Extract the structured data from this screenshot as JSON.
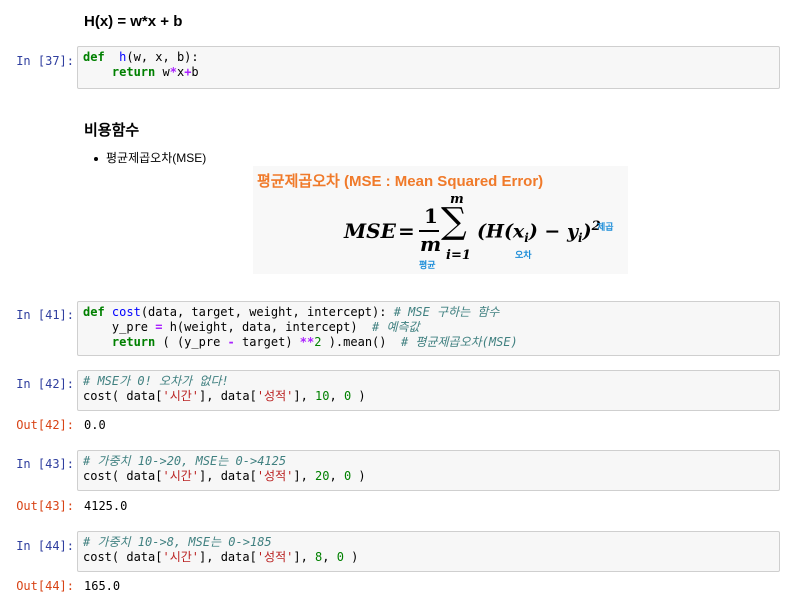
{
  "markdown": {
    "h1": "H(x) = w*x + b",
    "h2": "비용함수",
    "bullet": "평균제곱오차(MSE)"
  },
  "formula_image": {
    "title": "평균제곱오차 (MSE : Mean Squared Error)",
    "lhs": "MSE",
    "eq": "=",
    "frac_num": "1",
    "frac_den": "m",
    "sum_top": "m",
    "sum_bottom": "i=1",
    "body": "(H(x",
    "sub_i": "i",
    "minus_y": ") − y",
    "close": ")",
    "sq": "2",
    "label_avg": "평균",
    "label_err": "오차",
    "label_sq": "제곱",
    "title_color": "#f07a2a",
    "label_color": "#1a8cd8"
  },
  "cells": [
    {
      "prompt": "In [37]:",
      "lines": [
        [
          [
            "kw",
            "def"
          ],
          [
            "",
            "  "
          ],
          [
            "fn",
            "h"
          ],
          [
            "",
            "(w, x, b):"
          ]
        ],
        [
          [
            "",
            "    "
          ],
          [
            "kw",
            "return"
          ],
          [
            "",
            " w"
          ],
          [
            "op",
            "*"
          ],
          [
            "",
            "x"
          ],
          [
            "op",
            "+"
          ],
          [
            "",
            "b"
          ]
        ]
      ]
    },
    {
      "prompt": "In [41]:",
      "lines": [
        [
          [
            "kw",
            "def"
          ],
          [
            "",
            " "
          ],
          [
            "fn",
            "cost"
          ],
          [
            "",
            "(data, target, weight, intercept): "
          ],
          [
            "cm",
            "# MSE 구하는 함수"
          ]
        ],
        [
          [
            "",
            "    y_pre "
          ],
          [
            "op",
            "="
          ],
          [
            "",
            " h(weight, data, intercept)  "
          ],
          [
            "cm",
            "# 예측값"
          ]
        ],
        [
          [
            "",
            "    "
          ],
          [
            "kw",
            "return"
          ],
          [
            "",
            " ( (y_pre "
          ],
          [
            "op",
            "-"
          ],
          [
            "",
            " target) "
          ],
          [
            "op",
            "**"
          ],
          [
            "num",
            "2"
          ],
          [
            "",
            " ).mean()  "
          ],
          [
            "cm",
            "# 평균제곱오차(MSE)"
          ]
        ]
      ]
    },
    {
      "prompt": "In [42]:",
      "out_prompt": "Out[42]:",
      "output": "0.0",
      "lines": [
        [
          [
            "cm",
            "# MSE가 0! 오차가 없다!"
          ]
        ],
        [
          [
            "",
            "cost( data["
          ],
          [
            "str",
            "'시간'"
          ],
          [
            "",
            "], data["
          ],
          [
            "str",
            "'성적'"
          ],
          [
            "",
            "], "
          ],
          [
            "num",
            "10"
          ],
          [
            "",
            ", "
          ],
          [
            "num",
            "0"
          ],
          [
            "",
            " )"
          ]
        ]
      ]
    },
    {
      "prompt": "In [43]:",
      "out_prompt": "Out[43]:",
      "output": "4125.0",
      "lines": [
        [
          [
            "cm",
            "# 가중치 10->20, MSE는 0->4125"
          ]
        ],
        [
          [
            "",
            "cost( data["
          ],
          [
            "str",
            "'시간'"
          ],
          [
            "",
            "], data["
          ],
          [
            "str",
            "'성적'"
          ],
          [
            "",
            "], "
          ],
          [
            "num",
            "20"
          ],
          [
            "",
            ", "
          ],
          [
            "num",
            "0"
          ],
          [
            "",
            " )"
          ]
        ]
      ]
    },
    {
      "prompt": "In [44]:",
      "out_prompt": "Out[44]:",
      "output": "165.0",
      "lines": [
        [
          [
            "cm",
            "# 가중치 10->8, MSE는 0->185"
          ]
        ],
        [
          [
            "",
            "cost( data["
          ],
          [
            "str",
            "'시간'"
          ],
          [
            "",
            "], data["
          ],
          [
            "str",
            "'성적'"
          ],
          [
            "",
            "], "
          ],
          [
            "num",
            "8"
          ],
          [
            "",
            ", "
          ],
          [
            "num",
            "0"
          ],
          [
            "",
            " )"
          ]
        ]
      ]
    }
  ]
}
